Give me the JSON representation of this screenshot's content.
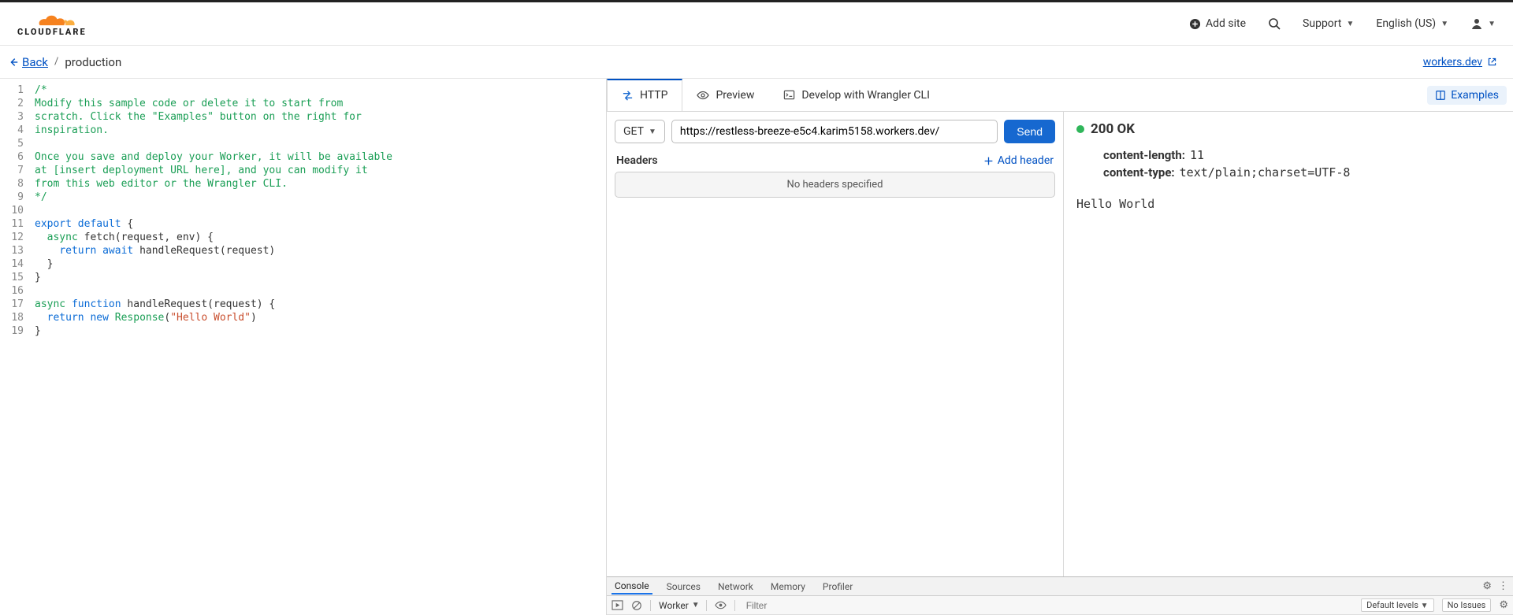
{
  "header": {
    "brand": "CLOUDFLARE",
    "add_site": "Add site",
    "support": "Support",
    "language": "English (US)"
  },
  "crumbs": {
    "back": "Back",
    "separator": "/",
    "env": "production",
    "domain": "workers.dev"
  },
  "editor": {
    "lines": [
      {
        "n": "1",
        "seg": [
          {
            "t": "/*",
            "c": "c-comment"
          }
        ]
      },
      {
        "n": "2",
        "seg": [
          {
            "t": "Modify this sample code or delete it to start from",
            "c": "c-comment"
          }
        ]
      },
      {
        "n": "3",
        "seg": [
          {
            "t": "scratch. Click the \"Examples\" button on the right for",
            "c": "c-comment"
          }
        ]
      },
      {
        "n": "4",
        "seg": [
          {
            "t": "inspiration.",
            "c": "c-comment"
          }
        ]
      },
      {
        "n": "5",
        "seg": [
          {
            "t": "",
            "c": "c-comment"
          }
        ]
      },
      {
        "n": "6",
        "seg": [
          {
            "t": "Once you save and deploy your Worker, it will be available",
            "c": "c-comment"
          }
        ]
      },
      {
        "n": "7",
        "seg": [
          {
            "t": "at [insert deployment URL here], and you can modify it",
            "c": "c-comment"
          }
        ]
      },
      {
        "n": "8",
        "seg": [
          {
            "t": "from this web editor or the Wrangler CLI.",
            "c": "c-comment"
          }
        ]
      },
      {
        "n": "9",
        "seg": [
          {
            "t": "*/",
            "c": "c-comment"
          }
        ]
      },
      {
        "n": "10",
        "seg": [
          {
            "t": ""
          }
        ]
      },
      {
        "n": "11",
        "seg": [
          {
            "t": "export",
            "c": "c-kw"
          },
          {
            "t": " "
          },
          {
            "t": "default",
            "c": "c-kw"
          },
          {
            "t": " {"
          }
        ]
      },
      {
        "n": "12",
        "seg": [
          {
            "t": "  "
          },
          {
            "t": "async",
            "c": "c-async"
          },
          {
            "t": " fetch(request, env) {"
          }
        ]
      },
      {
        "n": "13",
        "seg": [
          {
            "t": "    "
          },
          {
            "t": "return",
            "c": "c-kw"
          },
          {
            "t": " "
          },
          {
            "t": "await",
            "c": "c-kw"
          },
          {
            "t": " handleRequest(request)"
          }
        ]
      },
      {
        "n": "14",
        "seg": [
          {
            "t": "  }"
          }
        ]
      },
      {
        "n": "15",
        "seg": [
          {
            "t": "}"
          }
        ]
      },
      {
        "n": "16",
        "seg": [
          {
            "t": ""
          }
        ]
      },
      {
        "n": "17",
        "seg": [
          {
            "t": "async",
            "c": "c-async"
          },
          {
            "t": " "
          },
          {
            "t": "function",
            "c": "c-kw"
          },
          {
            "t": " handleRequest(request) {"
          }
        ]
      },
      {
        "n": "18",
        "seg": [
          {
            "t": "  "
          },
          {
            "t": "return",
            "c": "c-kw"
          },
          {
            "t": " "
          },
          {
            "t": "new",
            "c": "c-kw"
          },
          {
            "t": " "
          },
          {
            "t": "Response",
            "c": "c-func"
          },
          {
            "t": "("
          },
          {
            "t": "\"Hello World\"",
            "c": "c-str"
          },
          {
            "t": ")"
          }
        ]
      },
      {
        "n": "19",
        "seg": [
          {
            "t": "}"
          }
        ]
      }
    ]
  },
  "tabs": {
    "http": "HTTP",
    "preview": "Preview",
    "wrangler": "Develop with Wrangler CLI",
    "examples": "Examples"
  },
  "request": {
    "method": "GET",
    "url": "https://restless-breeze-e5c4.karim5158.workers.dev/",
    "send": "Send",
    "headers_label": "Headers",
    "add_header": "Add header",
    "no_headers": "No headers specified"
  },
  "response": {
    "status": "200 OK",
    "headers": [
      {
        "k": "content-length:",
        "v": "11"
      },
      {
        "k": "content-type:",
        "v": "text/plain;charset=UTF-8"
      }
    ],
    "body": "Hello World"
  },
  "devtools": {
    "tabs": [
      "Console",
      "Sources",
      "Network",
      "Memory",
      "Profiler"
    ],
    "active_tab": "Console",
    "context": "Worker",
    "filter_placeholder": "Filter",
    "levels": "Default levels",
    "issues": "No Issues"
  }
}
